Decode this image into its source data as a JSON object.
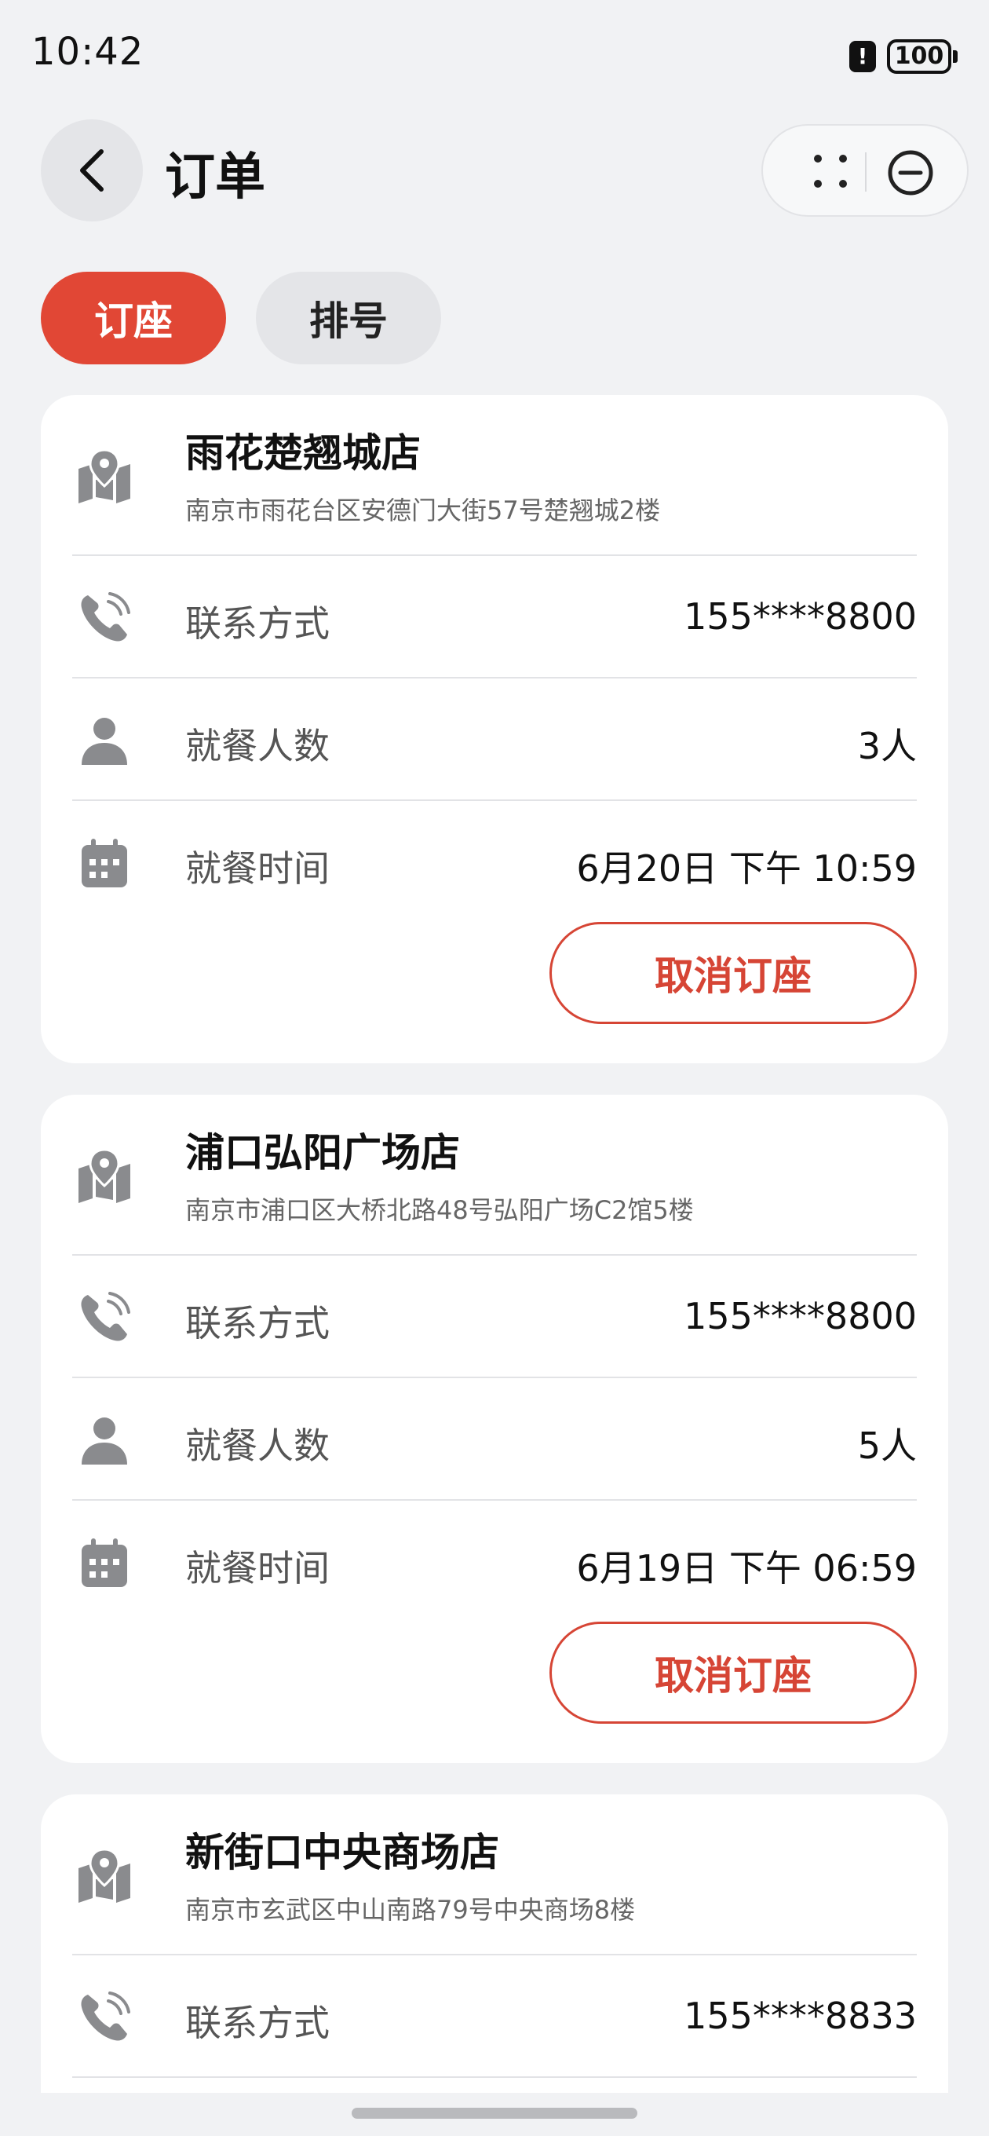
{
  "status_bar": {
    "time": "10:42",
    "alert": "!",
    "battery": "100"
  },
  "header": {
    "title": "订单"
  },
  "tabs": [
    {
      "label": "订座",
      "active": true
    },
    {
      "label": "排号",
      "active": false
    }
  ],
  "reservations": [
    {
      "store_name": "雨花楚翘城店",
      "address": "南京市雨花台区安德门大街57号楚翘城2楼",
      "contact_label": "联系方式",
      "contact_value": "155****8800",
      "party_label": "就餐人数",
      "party_value": "3人",
      "time_label": "就餐时间",
      "time_value": "6月20日 下午 10:59",
      "cancel_label": "取消订座"
    },
    {
      "store_name": "浦口弘阳广场店",
      "address": "南京市浦口区大桥北路48号弘阳广场C2馆5楼",
      "contact_label": "联系方式",
      "contact_value": "155****8800",
      "party_label": "就餐人数",
      "party_value": "5人",
      "time_label": "就餐时间",
      "time_value": "6月19日 下午 06:59",
      "cancel_label": "取消订座"
    },
    {
      "store_name": "新街口中央商场店",
      "address": "南京市玄武区中山南路79号中央商场8楼",
      "contact_label": "联系方式",
      "contact_value": "155****8833"
    }
  ],
  "icons": {
    "back": "chevron-left-icon",
    "more": "four-dots-icon",
    "close": "minus-circle-icon",
    "store": "map-pin-icon",
    "contact": "phone-icon",
    "party": "person-icon",
    "time": "calendar-icon"
  },
  "colors": {
    "accent": "#e14735",
    "background": "#f1f2f4",
    "card": "#ffffff",
    "icon_gray": "#8a8b8e"
  }
}
